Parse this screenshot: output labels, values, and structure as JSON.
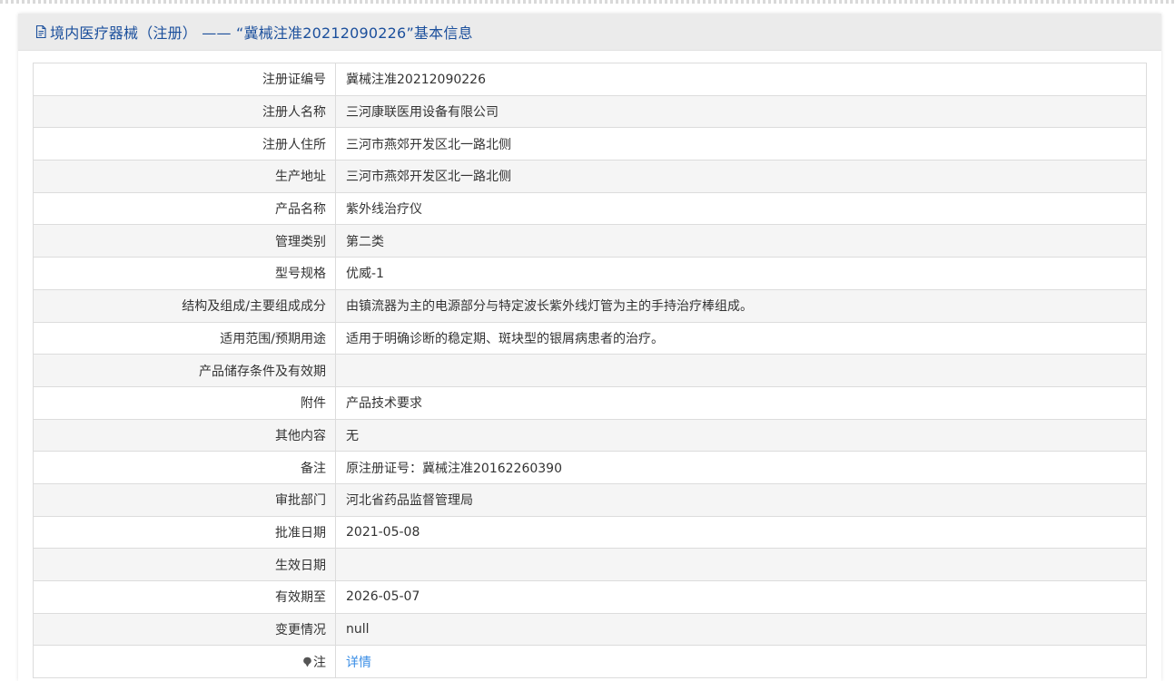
{
  "header": {
    "title": "境内医疗器械（注册） —— “冀械注准20212090226”基本信息",
    "icon": "document-icon"
  },
  "colors": {
    "title": "#1b4f9c",
    "link": "#3a8ee6",
    "header_bg": "#ebebeb",
    "alt_row_bg": "#f5f5f5"
  },
  "rows": [
    {
      "label": "注册证编号",
      "value": "冀械注准20212090226"
    },
    {
      "label": "注册人名称",
      "value": "三河康联医用设备有限公司"
    },
    {
      "label": "注册人住所",
      "value": "三河市燕郊开发区北一路北侧"
    },
    {
      "label": "生产地址",
      "value": "三河市燕郊开发区北一路北侧"
    },
    {
      "label": "产品名称",
      "value": "紫外线治疗仪"
    },
    {
      "label": "管理类别",
      "value": "第二类"
    },
    {
      "label": "型号规格",
      "value": "优威-1"
    },
    {
      "label": "结构及组成/主要组成成分",
      "value": "由镇流器为主的电源部分与特定波长紫外线灯管为主的手持治疗棒组成。"
    },
    {
      "label": "适用范围/预期用途",
      "value": "适用于明确诊断的稳定期、斑块型的银屑病患者的治疗。"
    },
    {
      "label": "产品储存条件及有效期",
      "value": ""
    },
    {
      "label": "附件",
      "value": "产品技术要求"
    },
    {
      "label": "其他内容",
      "value": "无"
    },
    {
      "label": "备注",
      "value": "原注册证号：冀械注准20162260390"
    },
    {
      "label": "审批部门",
      "value": "河北省药品监督管理局"
    },
    {
      "label": "批准日期",
      "value": "2021-05-08"
    },
    {
      "label": "生效日期",
      "value": ""
    },
    {
      "label": "有效期至",
      "value": "2026-05-07"
    },
    {
      "label": "变更情况",
      "value": "null"
    }
  ],
  "note": {
    "label": "注",
    "icon": "pin-icon",
    "link_text": "详情"
  }
}
